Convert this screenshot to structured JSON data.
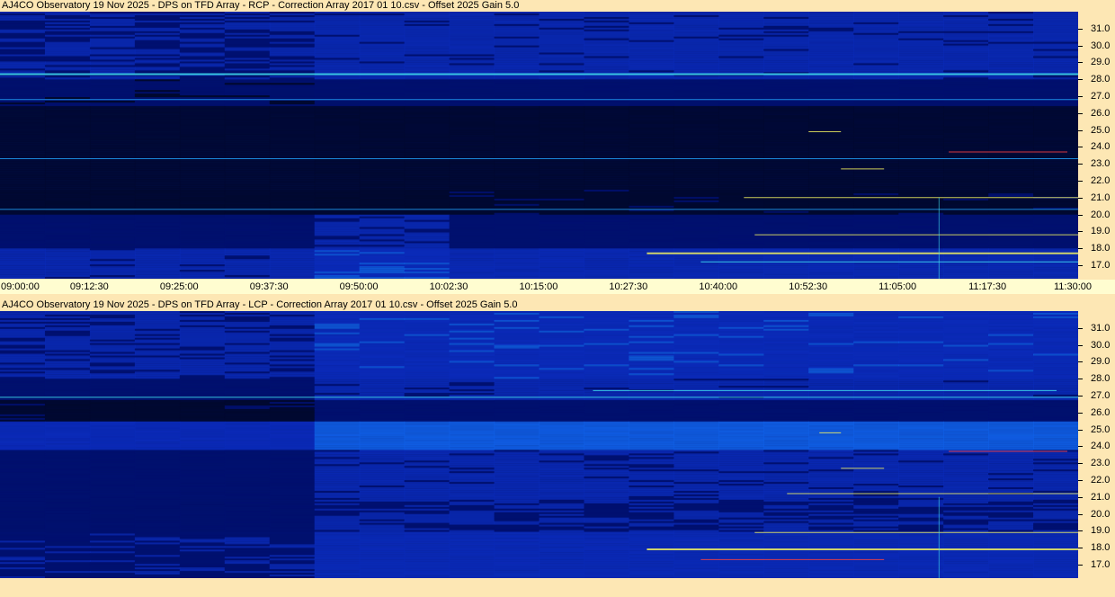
{
  "panels": [
    {
      "id": "rcp",
      "title": "AJ4CO Observatory 19 Nov 2025  -  DPS on TFD Array  -  RCP  -  Correction Array 2017 01 10.csv  -  Offset 2025  Gain 5.0",
      "polarization": "RCP"
    },
    {
      "id": "lcp",
      "title": "AJ4CO Observatory 19 Nov 2025  -  DPS on TFD Array  -  LCP  -  Correction Array 2017 01 10.csv  -  Offset 2025  Gain 5.0",
      "polarization": "LCP"
    }
  ],
  "chart_data": {
    "type": "heatmap",
    "x_axis": {
      "ticks": [
        "09:00:00",
        "09:12:30",
        "09:25:00",
        "09:37:30",
        "09:50:00",
        "10:02:30",
        "10:15:00",
        "10:27:30",
        "10:40:00",
        "10:52:30",
        "11:05:00",
        "11:17:30",
        "11:30:00"
      ]
    },
    "y_axis": {
      "ticks": [
        "31.0",
        "30.0",
        "29.0",
        "28.0",
        "27.0",
        "26.0",
        "25.0",
        "24.0",
        "23.0",
        "22.0",
        "21.0",
        "20.0",
        "19.0",
        "18.0",
        "17.0"
      ],
      "range": [
        16.2,
        32.0
      ]
    },
    "colormap": [
      "#00082f",
      "#001070",
      "#0a2ab8",
      "#1060e8",
      "#20a0f8",
      "#40e0f0",
      "#f0f060",
      "#ff4040"
    ]
  }
}
